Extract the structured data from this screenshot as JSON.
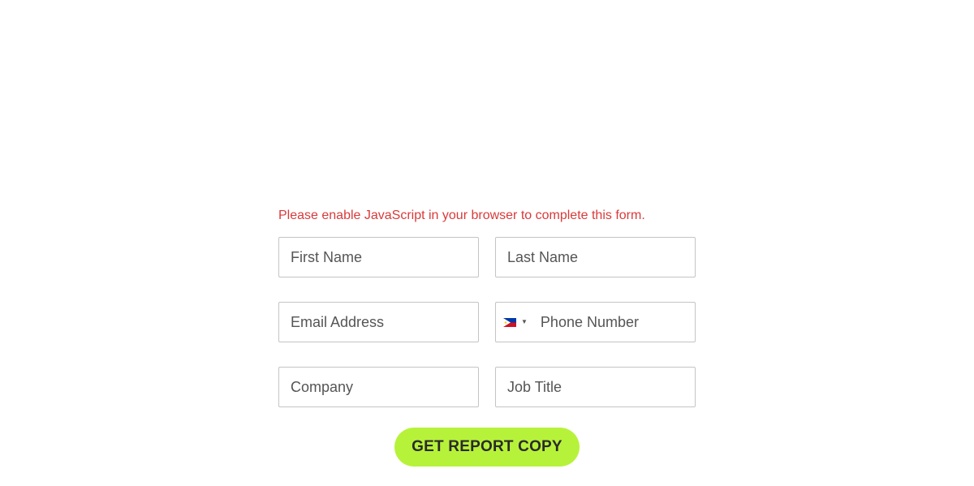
{
  "form": {
    "warning": "Please enable JavaScript in your browser to complete this form.",
    "fields": {
      "first_name": {
        "placeholder": "First Name",
        "value": ""
      },
      "last_name": {
        "placeholder": "Last Name",
        "value": ""
      },
      "email": {
        "placeholder": "Email Address",
        "value": ""
      },
      "phone": {
        "placeholder": "Phone Number",
        "value": "",
        "country_flag": "philippines-flag-icon"
      },
      "company": {
        "placeholder": "Company",
        "value": ""
      },
      "job_title": {
        "placeholder": "Job Title",
        "value": ""
      }
    },
    "submit_label": "GET REPORT COPY"
  },
  "colors": {
    "warning_text": "#d93a3a",
    "button_bg": "#b7f23a",
    "button_text": "#2a2a2a",
    "field_border": "#c4c4c4"
  }
}
